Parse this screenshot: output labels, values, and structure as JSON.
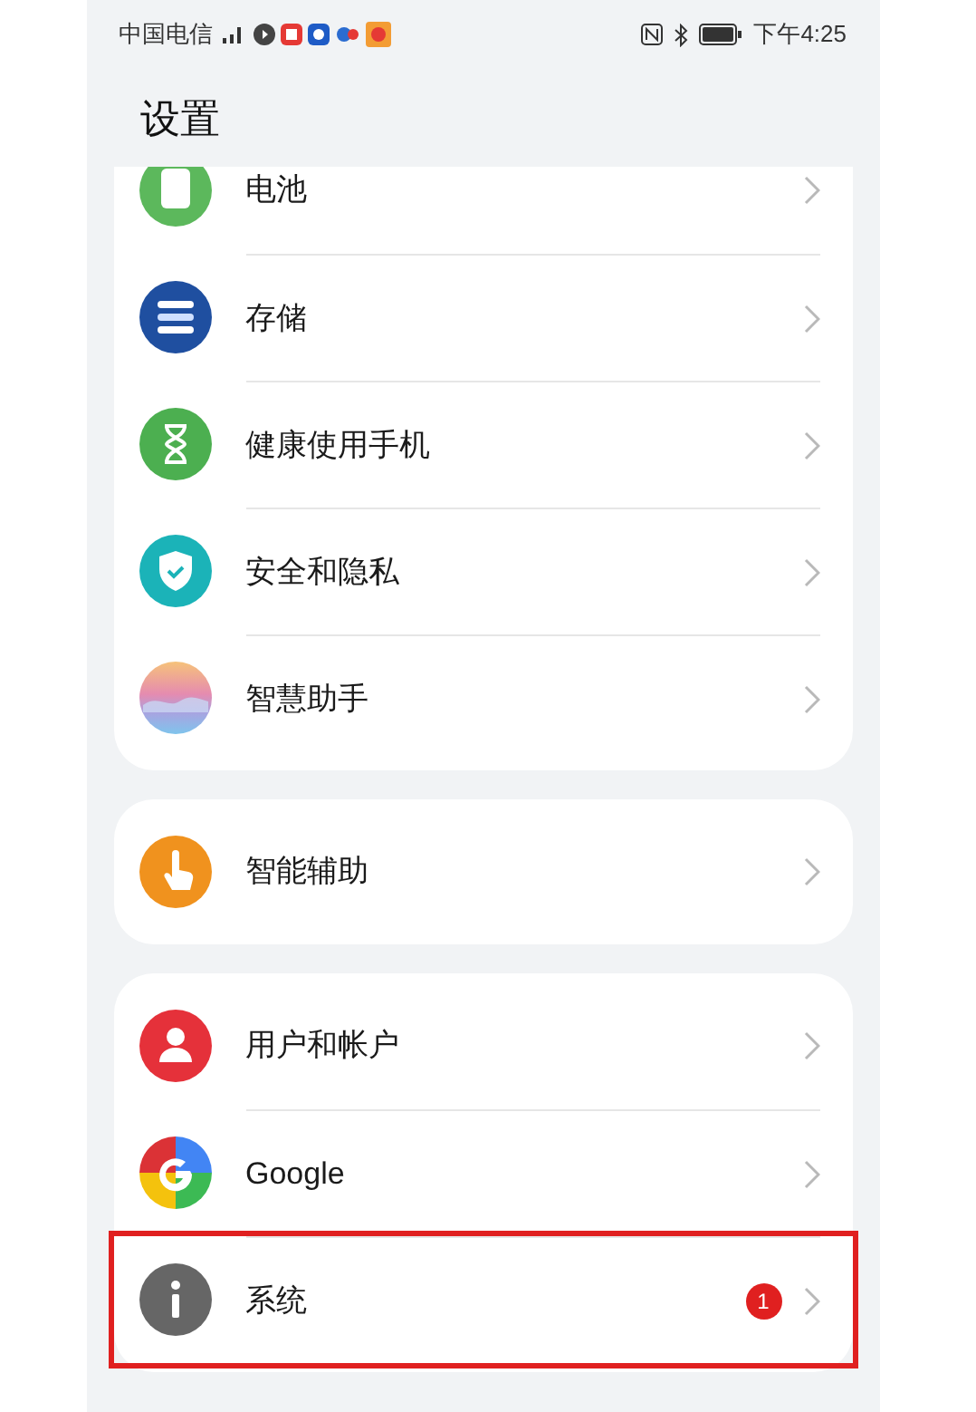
{
  "status_bar": {
    "carrier": "中国电信",
    "time": "下午4:25"
  },
  "title": "设置",
  "groups": [
    {
      "items": [
        {
          "label": "电池",
          "highlighted": false
        },
        {
          "label": "存储",
          "highlighted": false
        },
        {
          "label": "健康使用手机",
          "highlighted": false
        },
        {
          "label": "安全和隐私",
          "highlighted": false
        },
        {
          "label": "智慧助手",
          "highlighted": false
        }
      ]
    },
    {
      "items": [
        {
          "label": "智能辅助",
          "highlighted": false
        }
      ]
    },
    {
      "items": [
        {
          "label": "用户和帐户",
          "highlighted": false
        },
        {
          "label": "Google",
          "highlighted": false
        },
        {
          "label": "系统",
          "highlighted": true,
          "badge": "1"
        }
      ]
    }
  ]
}
